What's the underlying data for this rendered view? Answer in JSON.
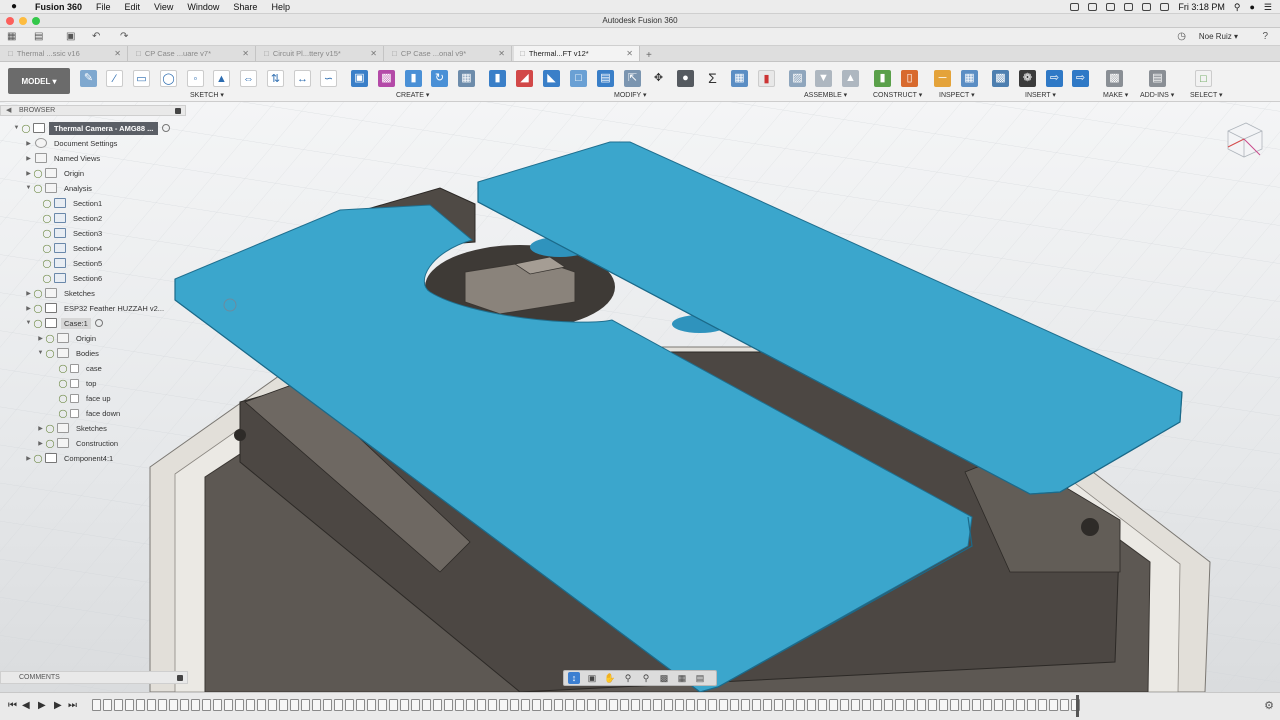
{
  "menubar": {
    "apple": "",
    "items": [
      "Fusion 360",
      "File",
      "Edit",
      "View",
      "Window",
      "Share",
      "Help"
    ],
    "clock": "Fri 3:18 PM"
  },
  "window": {
    "title": "Autodesk Fusion 360"
  },
  "quickbar": {
    "user": "Noe Ruiz ▾",
    "help": "?"
  },
  "tabs": [
    {
      "label": "Thermal ...ssic v16",
      "active": false
    },
    {
      "label": "CP Case ...uare v7*",
      "active": false
    },
    {
      "label": "Circuit Pl...ttery v15*",
      "active": false
    },
    {
      "label": "CP Case ...onal v9*",
      "active": false
    },
    {
      "label": "Thermal...FT v12*",
      "active": true
    }
  ],
  "ribbon": {
    "workspace": "MODEL ▾",
    "groups": [
      "SKETCH ▾",
      "CREATE ▾",
      "MODIFY ▾",
      "ASSEMBLE ▾",
      "CONSTRUCT ▾",
      "INSPECT ▾",
      "INSERT ▾",
      "MAKE ▾",
      "ADD-INS ▾",
      "SELECT ▾"
    ]
  },
  "browser": {
    "title": "BROWSER",
    "nodes": [
      {
        "label": "Thermal Camera - AMG88 ...",
        "type": "root"
      },
      {
        "label": "Document Settings"
      },
      {
        "label": "Named Views"
      },
      {
        "label": "Origin"
      },
      {
        "label": "Analysis"
      },
      {
        "label": "Section1"
      },
      {
        "label": "Section2"
      },
      {
        "label": "Section3"
      },
      {
        "label": "Section4"
      },
      {
        "label": "Section5"
      },
      {
        "label": "Section6"
      },
      {
        "label": "Sketches"
      },
      {
        "label": "ESP32 Feather HUZZAH v2..."
      },
      {
        "label": "Case:1"
      },
      {
        "label": "Origin"
      },
      {
        "label": "Bodies"
      },
      {
        "label": "case"
      },
      {
        "label": "top"
      },
      {
        "label": "face up"
      },
      {
        "label": "face down"
      },
      {
        "label": "Sketches"
      },
      {
        "label": "Construction"
      },
      {
        "label": "Component4:1"
      }
    ]
  },
  "comments": {
    "title": "COMMENTS"
  },
  "colors": {
    "accent_body": "#3ba6cc",
    "model_dark": "#4a4541",
    "shell": "#e2dfd9"
  }
}
